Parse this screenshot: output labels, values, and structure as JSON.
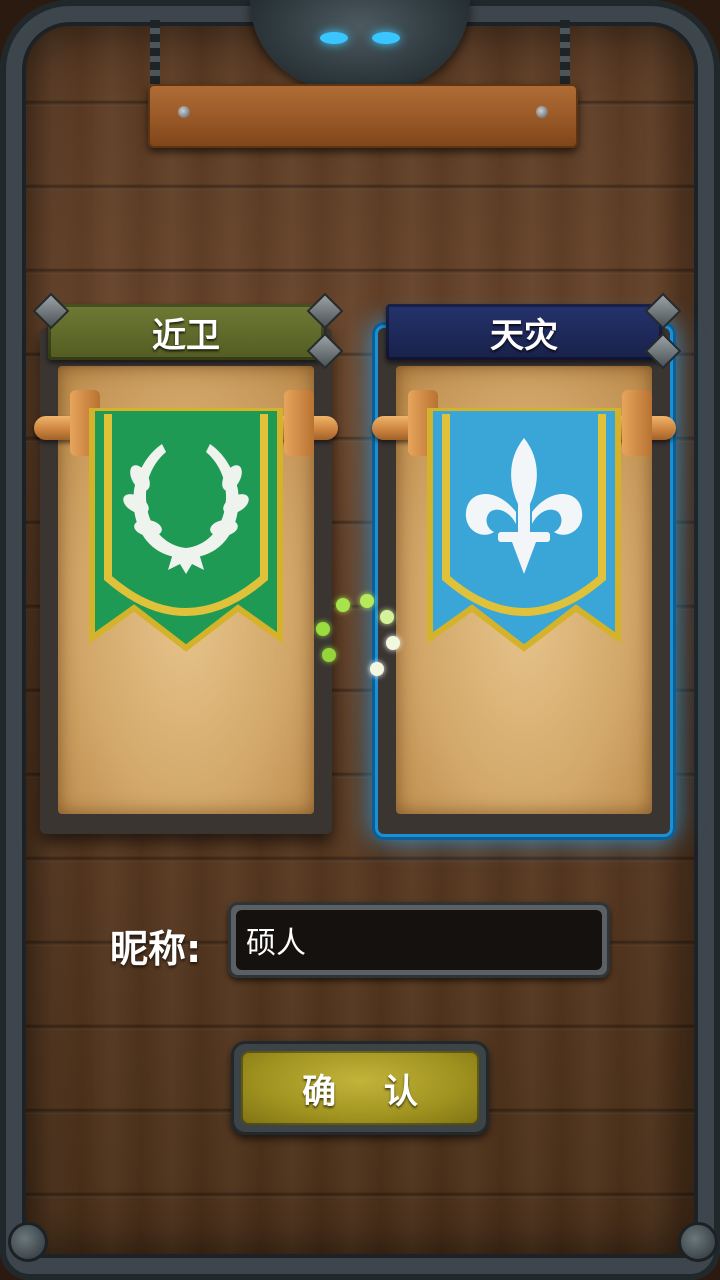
{
  "factions": [
    {
      "name": "近卫",
      "emblem": "laurel-wreath-icon",
      "header_color": "#5f6a2c",
      "banner_color": "#1f9a55",
      "selected": false
    },
    {
      "name": "天灾",
      "emblem": "fleur-de-lis-icon",
      "header_color": "#1e2a5e",
      "banner_color": "#3aa6d8",
      "selected": true
    }
  ],
  "nickname": {
    "label": "昵称:",
    "value": "硕人"
  },
  "confirm_label": "确 认",
  "colors": {
    "selection_glow": "#28aaff",
    "trim_gold": "#d4b22a",
    "button": "#a8992a"
  }
}
